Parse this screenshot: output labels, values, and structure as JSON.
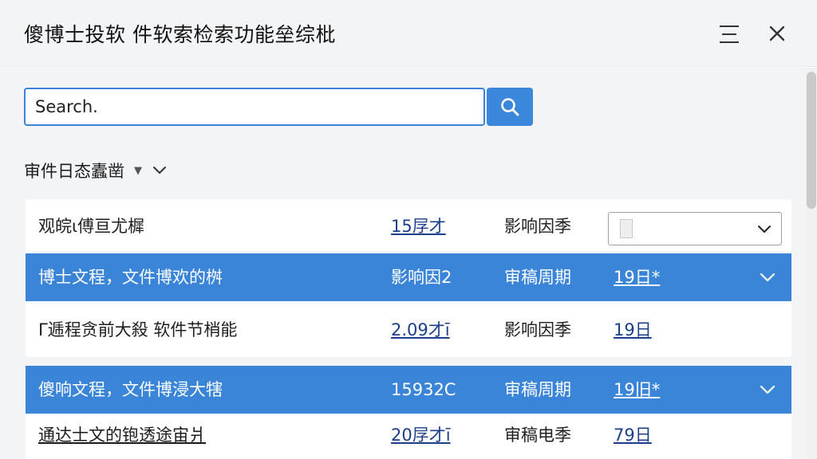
{
  "window": {
    "title": "傻博士投软 件软索检索功能垒综枇"
  },
  "search": {
    "value": "Search.",
    "button_icon": "search-icon"
  },
  "filter": {
    "label": "审件日态蠹凿",
    "icons": [
      "caret-down-icon",
      "chevron-down-icon"
    ]
  },
  "rows": [
    {
      "name": "观皖ι傅亘尤樨",
      "value": "15㞌才",
      "type": "影响因季",
      "date": "",
      "selected": false,
      "has_dropdown": true
    },
    {
      "name": "博士文程，文件博欢的桝",
      "value": "影响因2",
      "type": "审稿周期",
      "date": "19日*",
      "selected": true,
      "has_dropdown": false
    },
    {
      "name": "Γ逓程贪前大殺 软件节梢能",
      "value": "2.09才ī",
      "type": "影响因季",
      "date": "19日",
      "selected": false,
      "has_dropdown": false
    },
    {
      "name": "傻响文程，文件博浸大犗",
      "value": "15932C",
      "type": "审稿周期",
      "date": "19旧*",
      "selected": true,
      "has_dropdown": false
    },
    {
      "name": "通达士文的铇透途宙爿",
      "value": "20㞌才ī",
      "type": "审稿电季",
      "date": "79日",
      "selected": false,
      "has_dropdown": false
    }
  ],
  "colors": {
    "accent": "#3a85d8",
    "background": "#f3f4f6",
    "link": "#1c3f8c"
  }
}
